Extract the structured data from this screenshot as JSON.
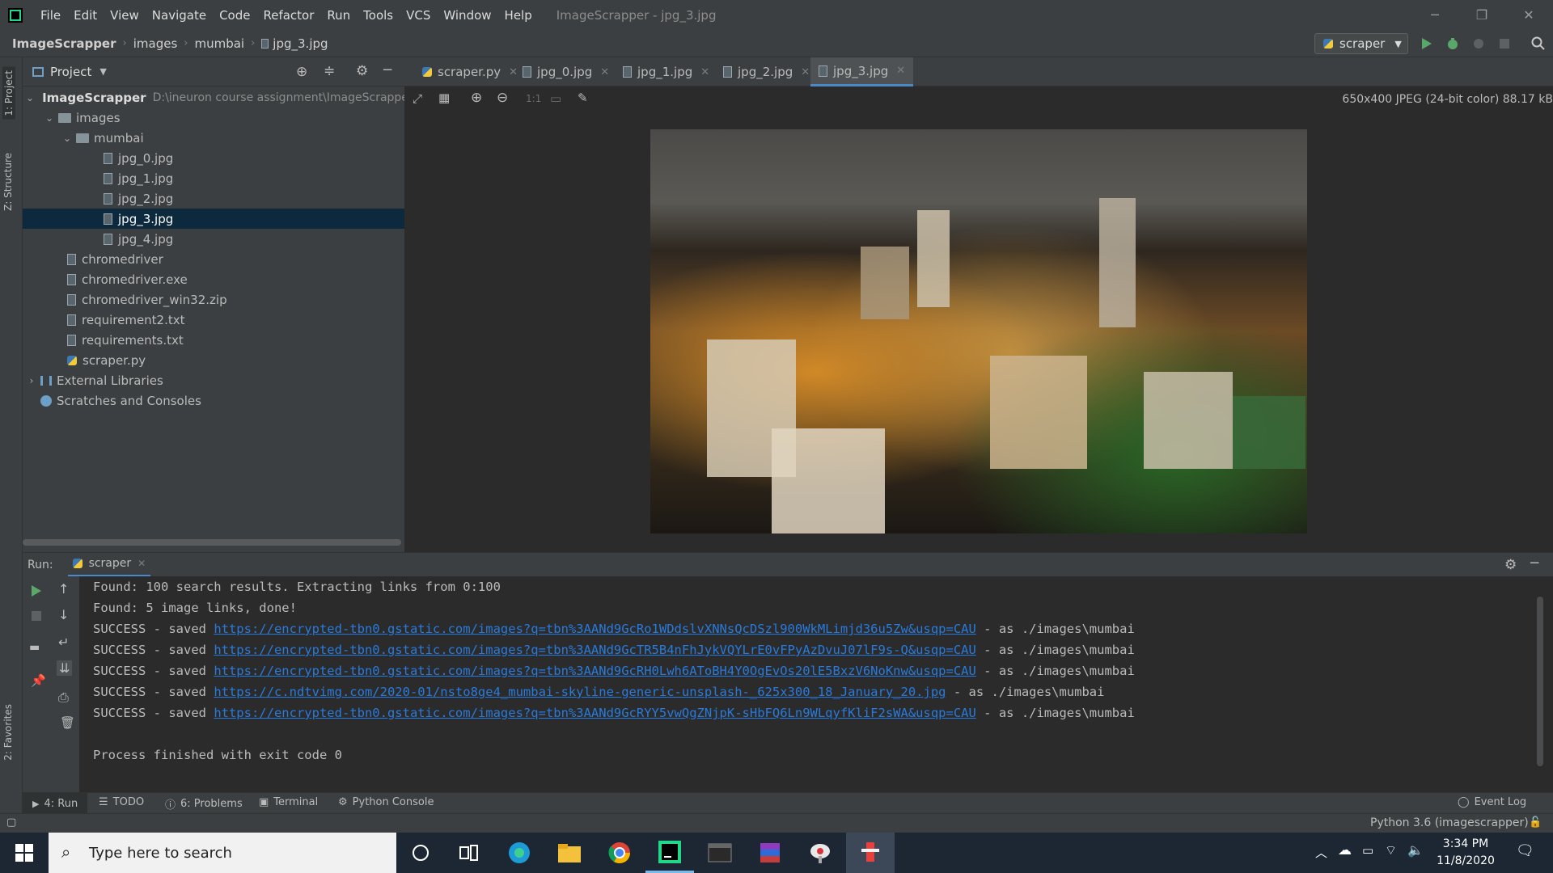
{
  "titlebar": {
    "menu": [
      "File",
      "Edit",
      "View",
      "Navigate",
      "Code",
      "Refactor",
      "Run",
      "Tools",
      "VCS",
      "Window",
      "Help"
    ],
    "window_title": "ImageScrapper - jpg_3.jpg",
    "minimize": "─",
    "restore": "❐",
    "close": "✕"
  },
  "breadcrumbs": [
    "ImageScrapper",
    "images",
    "mumbai",
    "jpg_3.jpg"
  ],
  "run_config": "scraper",
  "left_stripe": {
    "project": "1: Project",
    "structure": "Z: Structure",
    "favorites": "2: Favorites"
  },
  "project": {
    "header": "Project",
    "root_name": "ImageScrapper",
    "root_path": "D:\\ineuron course assignment\\ImageScrapper",
    "images": "images",
    "mumbai": "mumbai",
    "files_mumbai": [
      "jpg_0.jpg",
      "jpg_1.jpg",
      "jpg_2.jpg",
      "jpg_3.jpg",
      "jpg_4.jpg"
    ],
    "files_root": [
      "chromedriver",
      "chromedriver.exe",
      "chromedriver_win32.zip",
      "requirement2.txt",
      "requirements.txt",
      "scraper.py"
    ],
    "external": "External Libraries",
    "scratches": "Scratches and Consoles"
  },
  "editor_tabs": [
    "scraper.py",
    "jpg_0.jpg",
    "jpg_1.jpg",
    "jpg_2.jpg",
    "jpg_3.jpg"
  ],
  "image_toolbar": {
    "ratio": "1:1"
  },
  "image_info": "650x400 JPEG (24-bit color) 88.17 kB",
  "run": {
    "label": "Run:",
    "tab": "scraper",
    "lines": [
      {
        "text": "Found: 100 search results. Extracting links from 0:100"
      },
      {
        "text": "Found: 5 image links, done!"
      },
      {
        "prefix": "SUCCESS - saved ",
        "link": "https://encrypted-tbn0.gstatic.com/images?q=tbn%3AANd9GcRo1WDdslvXNNsQcDSzl900WkMLimjd36u5Zw&usqp=CAU",
        "suffix": " - as ./images\\mumbai"
      },
      {
        "prefix": "SUCCESS - saved ",
        "link": "https://encrypted-tbn0.gstatic.com/images?q=tbn%3AANd9GcTR5B4nFhJykVQYLrE0vFPyAzDvuJ07lF9s-Q&usqp=CAU",
        "suffix": " - as ./images\\mumbai"
      },
      {
        "prefix": "SUCCESS - saved ",
        "link": "https://encrypted-tbn0.gstatic.com/images?q=tbn%3AANd9GcRH0Lwh6AToBH4Y0OgEvOs20lE5BxzV6NoKnw&usqp=CAU",
        "suffix": " - as ./images\\mumbai"
      },
      {
        "prefix": "SUCCESS - saved ",
        "link": "https://c.ndtvimg.com/2020-01/nsto8ge4_mumbai-skyline-generic-unsplash-_625x300_18_January_20.jpg",
        "suffix": " - as ./images\\mumbai"
      },
      {
        "prefix": "SUCCESS - saved ",
        "link": "https://encrypted-tbn0.gstatic.com/images?q=tbn%3AANd9GcRYY5vwQgZNjpK-sHbFQ6Ln9WLqyfKliF2sWA&usqp=CAU",
        "suffix": " - as ./images\\mumbai"
      },
      {
        "text": ""
      },
      {
        "text": "Process finished with exit code 0"
      }
    ]
  },
  "bottom_tabs": {
    "run": "4: Run",
    "todo": "TODO",
    "problems": "6: Problems",
    "terminal": "Terminal",
    "python_console": "Python Console",
    "event_log": "Event Log"
  },
  "status": {
    "interpreter": "Python 3.6 (imagescrapper)"
  },
  "taskbar": {
    "search_placeholder": "Type here to search",
    "time": "3:34 PM",
    "date": "11/8/2020"
  }
}
